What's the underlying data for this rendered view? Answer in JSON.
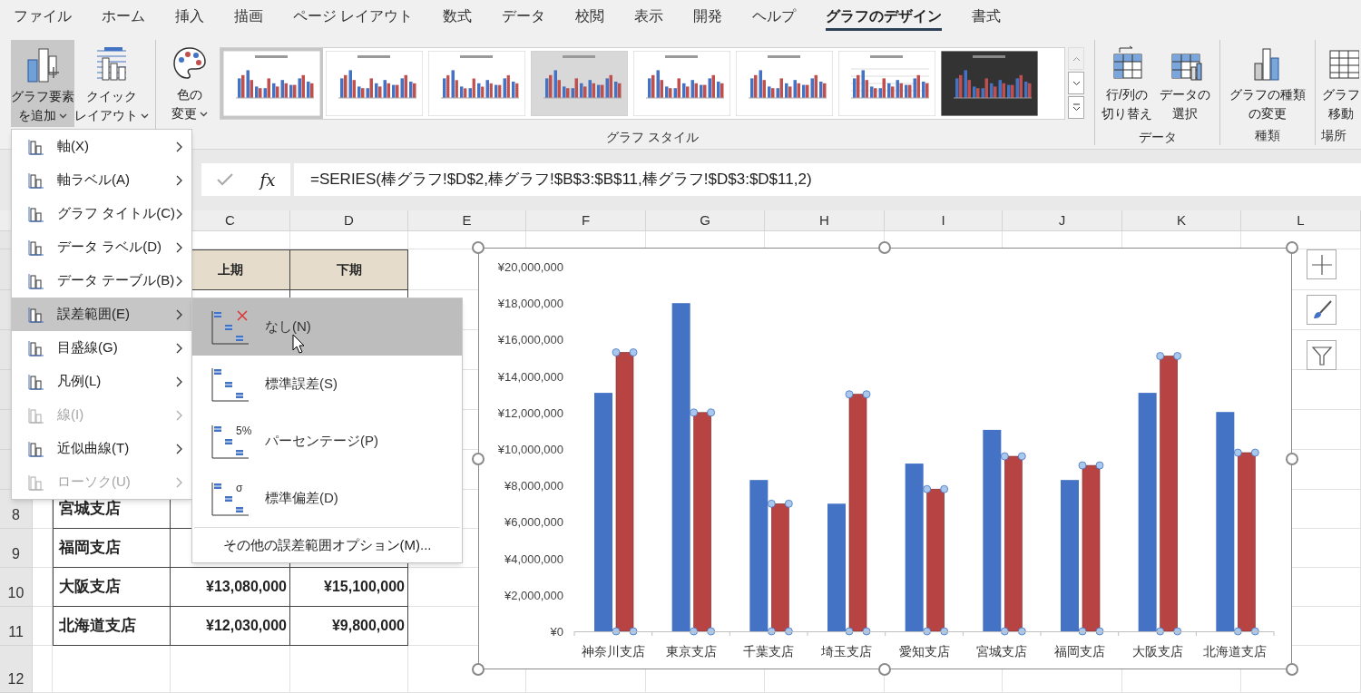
{
  "tabs": [
    {
      "label": "ファイル",
      "selected": false
    },
    {
      "label": "ホーム",
      "selected": false
    },
    {
      "label": "挿入",
      "selected": false
    },
    {
      "label": "描画",
      "selected": false
    },
    {
      "label": "ページ レイアウト",
      "selected": false
    },
    {
      "label": "数式",
      "selected": false
    },
    {
      "label": "データ",
      "selected": false
    },
    {
      "label": "校閲",
      "selected": false
    },
    {
      "label": "表示",
      "selected": false
    },
    {
      "label": "開発",
      "selected": false
    },
    {
      "label": "ヘルプ",
      "selected": false
    },
    {
      "label": "グラフのデザイン",
      "selected": true
    },
    {
      "label": "書式",
      "selected": false
    }
  ],
  "ribbon": {
    "layout_buttons": [
      {
        "lines": [
          "グラフ要素",
          "を追加"
        ],
        "dropdown": true,
        "pressed": true,
        "kind": "add_element"
      },
      {
        "lines": [
          "クイック",
          "レイアウト"
        ],
        "dropdown": true,
        "pressed": false,
        "kind": "quick_layout"
      }
    ],
    "color_button": {
      "lines": [
        "色の",
        "変更"
      ],
      "dropdown": true
    },
    "styles": [
      {
        "kind": "light",
        "selected": true
      },
      {
        "kind": "light",
        "selected": false
      },
      {
        "kind": "dotted",
        "selected": false
      },
      {
        "kind": "shaded",
        "selected": false
      },
      {
        "kind": "light",
        "selected": false
      },
      {
        "kind": "light",
        "selected": false
      },
      {
        "kind": "grid",
        "selected": false
      },
      {
        "kind": "dark",
        "selected": false
      }
    ],
    "styles_label": "グラフ スタイル",
    "data_buttons": [
      {
        "lines": [
          "行/列の",
          "切り替え"
        ],
        "kind": "switch"
      },
      {
        "lines": [
          "データの",
          "選択"
        ],
        "kind": "select"
      }
    ],
    "data_label": "データ",
    "type_button": {
      "lines": [
        "グラフの種類",
        "の変更"
      ]
    },
    "type_label": "種類",
    "move_button": {
      "lines": [
        "グラフ",
        "移動"
      ]
    },
    "location_label": "場所"
  },
  "formula_bar": {
    "function_label": "fx",
    "value": "=SERIES(棒グラフ!$D$2,棒グラフ!$B$3:$B$11,棒グラフ!$D$3:$D$11,2)"
  },
  "sheet": {
    "columns": [
      "C",
      "D",
      "E",
      "F",
      "G",
      "H",
      "I",
      "J",
      "K",
      "L"
    ],
    "header": {
      "first_half": "上期",
      "second_half": "下期"
    },
    "rows": [
      {
        "number": "8",
        "branch": "宮城支店"
      },
      {
        "number": "9",
        "branch": "福岡支店"
      },
      {
        "number": "10",
        "branch": "大阪支店",
        "first_half": "¥13,080,000",
        "second_half": "¥15,100,000"
      },
      {
        "number": "11",
        "branch": "北海道支店",
        "first_half": "¥12,030,000",
        "second_half": "¥9,800,000"
      },
      {
        "number": "12"
      }
    ]
  },
  "menu": {
    "items": [
      {
        "label": "軸(X)",
        "disabled": false,
        "selected": false
      },
      {
        "label": "軸ラベル(A)",
        "disabled": false,
        "selected": false
      },
      {
        "label": "グラフ タイトル(C)",
        "disabled": false,
        "selected": false
      },
      {
        "label": "データ ラベル(D)",
        "disabled": false,
        "selected": false
      },
      {
        "label": "データ テーブル(B)",
        "disabled": false,
        "selected": false
      },
      {
        "label": "誤差範囲(E)",
        "disabled": false,
        "selected": true
      },
      {
        "label": "目盛線(G)",
        "disabled": false,
        "selected": false
      },
      {
        "label": "凡例(L)",
        "disabled": false,
        "selected": false
      },
      {
        "label": "線(I)",
        "disabled": true,
        "selected": false
      },
      {
        "label": "近似曲線(T)",
        "disabled": false,
        "selected": false
      },
      {
        "label": "ローソク(U)",
        "disabled": true,
        "selected": false
      }
    ]
  },
  "submenu": {
    "items": [
      {
        "label": "なし(N)",
        "kind": "none",
        "selected": true
      },
      {
        "label": "標準誤差(S)",
        "kind": "plain",
        "selected": false
      },
      {
        "label": "パーセンテージ(P)",
        "kind": "marked",
        "icon_text": "5%",
        "selected": false
      },
      {
        "label": "標準偏差(D)",
        "kind": "marked",
        "icon_text": "σ",
        "selected": false
      }
    ],
    "more": "その他の誤差範囲オプション(M)..."
  },
  "chart": {
    "selected": true,
    "series_states": [
      {
        "selected": false
      },
      {
        "selected": true
      }
    ],
    "chart_data": {
      "type": "bar",
      "categories": [
        "神奈川支店",
        "東京支店",
        "千葉支店",
        "埼玉支店",
        "愛知支店",
        "宮城支店",
        "福岡支店",
        "大阪支店",
        "北海道支店"
      ],
      "series": [
        {
          "color": "#4472c4",
          "values": [
            13080000,
            18000000,
            8300000,
            7000000,
            9200000,
            11050000,
            8300000,
            13080000,
            12030000
          ]
        },
        {
          "color": "#b84343",
          "values": [
            15300000,
            12000000,
            7000000,
            13000000,
            7800000,
            9600000,
            9100000,
            15100000,
            9800000
          ]
        }
      ],
      "ylim": [
        0,
        20000000
      ],
      "yticks": [
        {
          "value": 0,
          "label": "¥0"
        },
        {
          "value": 2000000,
          "label": "¥2,000,000"
        },
        {
          "value": 4000000,
          "label": "¥4,000,000"
        },
        {
          "value": 6000000,
          "label": "¥6,000,000"
        },
        {
          "value": 8000000,
          "label": "¥8,000,000"
        },
        {
          "value": 10000000,
          "label": "¥10,000,000"
        },
        {
          "value": 12000000,
          "label": "¥12,000,000"
        },
        {
          "value": 14000000,
          "label": "¥14,000,000"
        },
        {
          "value": 16000000,
          "label": "¥16,000,000"
        },
        {
          "value": 18000000,
          "label": "¥18,000,000"
        },
        {
          "value": 20000000,
          "label": "¥20,000,000"
        }
      ]
    }
  }
}
